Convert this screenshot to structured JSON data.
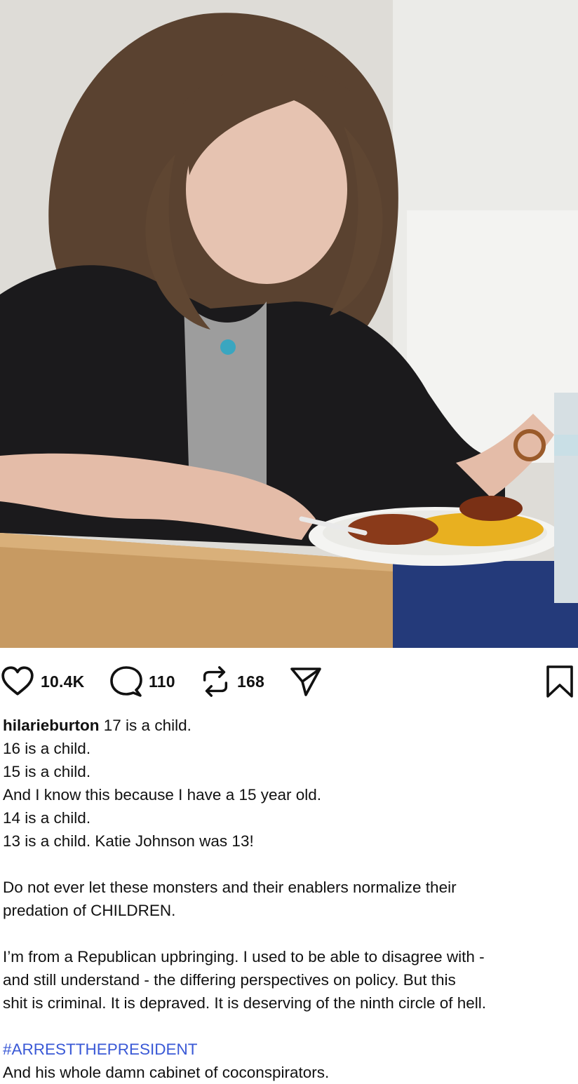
{
  "post": {
    "image": {
      "icon": "photo-of-person-eating",
      "palette": {
        "wall": "#dcdcd8",
        "hair": "#5a4230",
        "cardigan": "#1b1a1c",
        "shirt": "#9d9d9d",
        "skin": "#e6c3b1",
        "table": "#c79a62",
        "plate": "#f4f4f2",
        "rice": "#e8b020",
        "chicken": "#8a3a1a"
      }
    },
    "actions": {
      "likes": {
        "icon": "heart-icon",
        "count": "10.4K"
      },
      "comments": {
        "icon": "comment-icon",
        "count": "110"
      },
      "reposts": {
        "icon": "repost-icon",
        "count": "168"
      },
      "share": {
        "icon": "send-icon"
      },
      "save": {
        "icon": "bookmark-icon"
      }
    },
    "caption": {
      "username": "hilarieburton",
      "lines": [
        "17 is a child.",
        "16 is a child.",
        "15 is a child.",
        "And I know this because I have a 15 year old.",
        "14 is a child.",
        "13 is a child. Katie Johnson was 13!"
      ],
      "paragraph2": [
        "Do not ever let these monsters and their enablers normalize their",
        "predation of CHILDREN."
      ],
      "paragraph3": [
        "I’m from a Republican upbringing. I used to be able to disagree with -",
        "and still understand - the differing perspectives on policy. But this",
        "shit is criminal. It is depraved. It is deserving of the ninth circle of hell."
      ],
      "hashtag": "#ARRESTTHEPRESIDENT",
      "closing": "And his whole damn cabinet of coconspirators."
    },
    "colors": {
      "hashtag": "#3a59d6",
      "text": "#111111"
    }
  }
}
